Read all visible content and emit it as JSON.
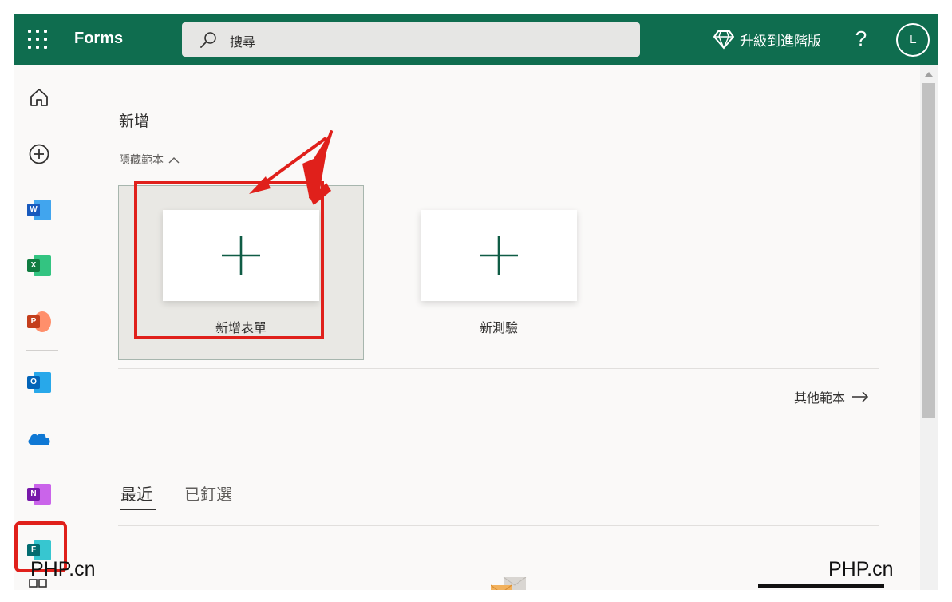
{
  "header": {
    "app_name": "Forms",
    "search_placeholder": "搜尋",
    "upgrade_label": "升級到進階版",
    "help_label": "?",
    "avatar_initial": "L",
    "color": "#0f6d4f"
  },
  "rail": {
    "items": [
      "home-icon",
      "create-icon",
      "word-icon",
      "excel-icon",
      "powerpoint-icon",
      "outlook-icon",
      "onedrive-icon",
      "onenote-icon",
      "forms-icon"
    ],
    "tiles": {
      "word": "W",
      "excel": "X",
      "powerpoint": "P",
      "outlook": "O",
      "onenote": "N",
      "forms": "F"
    }
  },
  "main": {
    "section_title": "新增",
    "hide_templates": "隱藏範本",
    "new_form_label": "新增表單",
    "new_quiz_label": "新測驗",
    "more_templates": "其他範本",
    "tabs": [
      {
        "label": "最近",
        "selected": true
      },
      {
        "label": "已釘選",
        "selected": false
      }
    ]
  },
  "watermark": "PHP.cn",
  "colors": {
    "accent": "#0f6d4f",
    "highlight": "#e0201b",
    "plus": "#0f5c45"
  }
}
